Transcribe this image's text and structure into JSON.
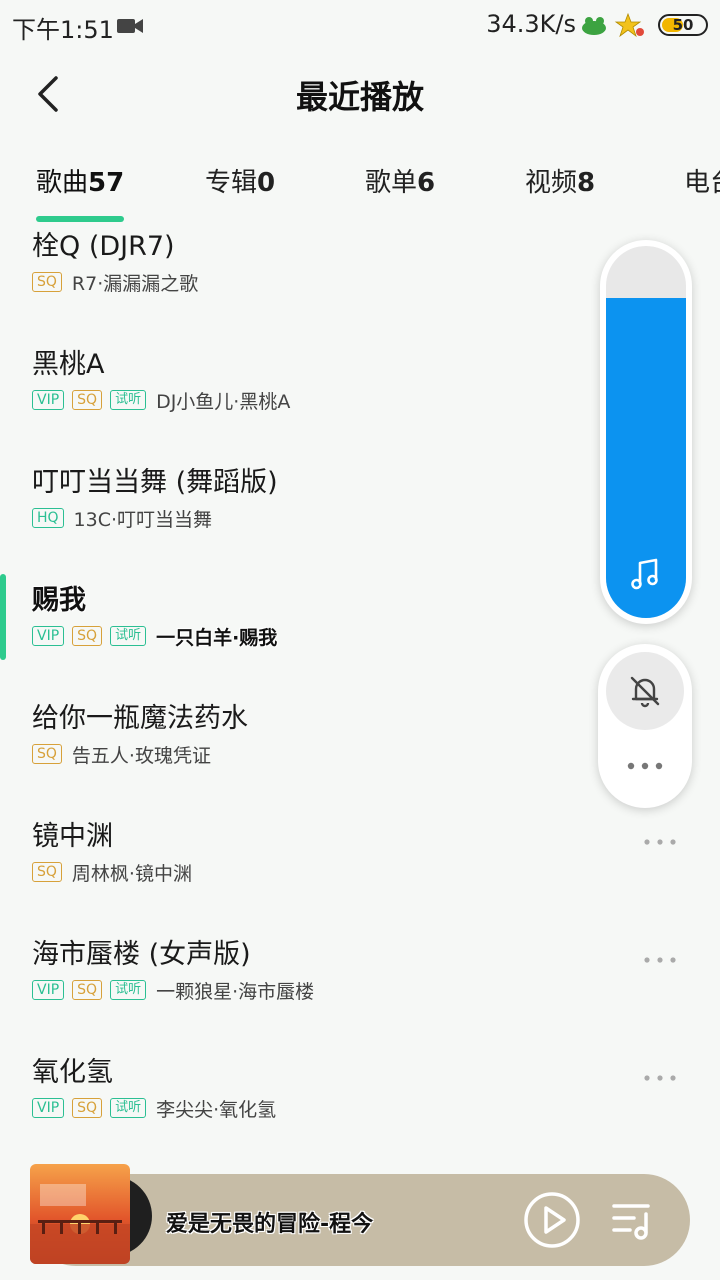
{
  "status_bar": {
    "time": "下午1:51",
    "network_speed": "34.3K/s",
    "battery_level": "50",
    "battery_fraction": 0.5,
    "icons": [
      "video-camera-icon",
      "app-notification-icon",
      "star-notification-icon",
      "battery-icon"
    ]
  },
  "header": {
    "title": "最近播放",
    "back_icon": "back-arrow-icon"
  },
  "tabs": [
    {
      "label": "歌曲",
      "count": "57",
      "active": true
    },
    {
      "label": "专辑",
      "count": "0",
      "active": false
    },
    {
      "label": "歌单",
      "count": "6",
      "active": false
    },
    {
      "label": "视频",
      "count": "8",
      "active": false
    },
    {
      "label": "电台",
      "count": "",
      "active": false
    }
  ],
  "songs": [
    {
      "title": "栓Q (DJR7)",
      "tags": [
        "SQ"
      ],
      "artist": "R7·漏漏漏之歌"
    },
    {
      "title": "黑桃A",
      "tags": [
        "VIP",
        "SQ",
        "试听"
      ],
      "artist": "DJ小鱼儿·黑桃A"
    },
    {
      "title": "叮叮当当舞 (舞蹈版)",
      "tags": [
        "HQ"
      ],
      "artist": "13C·叮叮当当舞"
    },
    {
      "title": "赐我",
      "tags": [
        "VIP",
        "SQ",
        "试听"
      ],
      "artist": "一只白羊·赐我",
      "current": true
    },
    {
      "title": "给你一瓶魔法药水",
      "tags": [
        "SQ"
      ],
      "artist": "告五人·玫瑰凭证"
    },
    {
      "title": "镜中渊",
      "tags": [
        "SQ"
      ],
      "artist": "周林枫·镜中渊"
    },
    {
      "title": "海市蜃楼 (女声版)",
      "tags": [
        "VIP",
        "SQ",
        "试听"
      ],
      "artist": "一颗狼星·海市蜃楼"
    },
    {
      "title": "氧化氢",
      "tags": [
        "VIP",
        "SQ",
        "试听"
      ],
      "artist": "李尖尖·氧化氢"
    }
  ],
  "volume_overlay": {
    "level": 0.86,
    "accent": "#0c93f0",
    "music_icon": "music-note-icon",
    "mute_icon": "bell-off-icon",
    "more_icon": "more-dots-icon"
  },
  "player": {
    "now_playing": "爱是无畏的冒险-程今",
    "play_icon": "play-icon",
    "playlist_icon": "playlist-icon"
  },
  "colors": {
    "accent_green": "#2ecb8d",
    "sq_tag": "#d7a13a",
    "vip_tag": "#2bbf93"
  }
}
